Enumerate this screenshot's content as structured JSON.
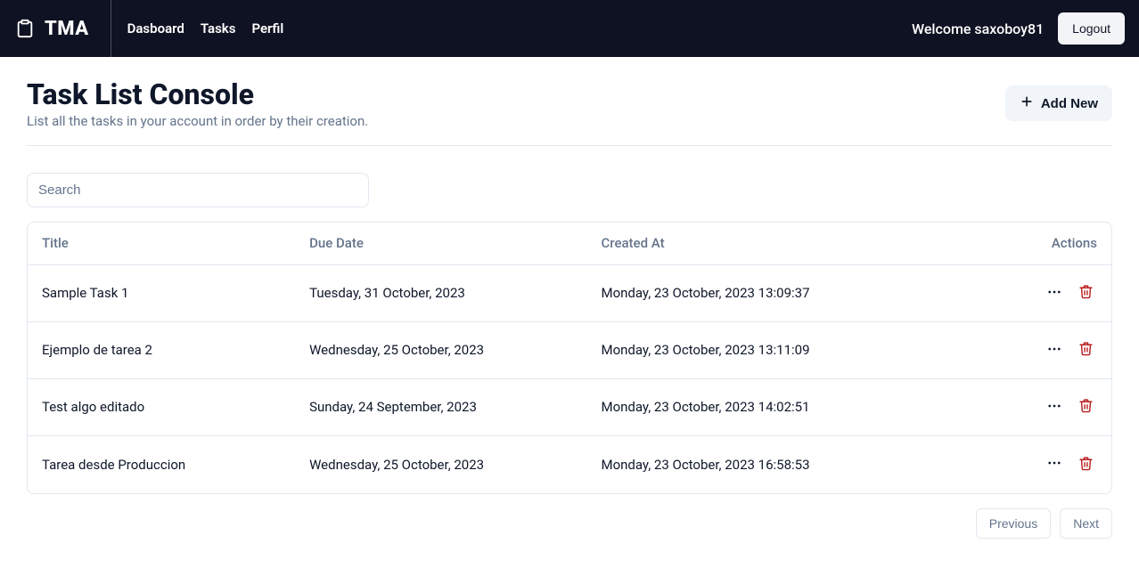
{
  "header": {
    "logo_text": "TMA",
    "nav": [
      {
        "label": "Dasboard"
      },
      {
        "label": "Tasks"
      },
      {
        "label": "Perfil"
      }
    ],
    "welcome_text": "Welcome saxoboy81",
    "logout_label": "Logout"
  },
  "page": {
    "title": "Task List Console",
    "subtitle": "List all the tasks in your account in order by their creation.",
    "add_label": "Add New",
    "search_placeholder": "Search"
  },
  "table": {
    "columns": {
      "title": "Title",
      "due": "Due Date",
      "created": "Created At",
      "actions": "Actions"
    },
    "rows": [
      {
        "title": "Sample Task 1",
        "due": "Tuesday, 31 October, 2023",
        "created": "Monday, 23 October, 2023 13:09:37"
      },
      {
        "title": "Ejemplo de tarea 2",
        "due": "Wednesday, 25 October, 2023",
        "created": "Monday, 23 October, 2023 13:11:09"
      },
      {
        "title": "Test algo editado",
        "due": "Sunday, 24 September, 2023",
        "created": "Monday, 23 October, 2023 14:02:51"
      },
      {
        "title": "Tarea desde Produccion",
        "due": "Wednesday, 25 October, 2023",
        "created": "Monday, 23 October, 2023 16:58:53"
      }
    ]
  },
  "pagination": {
    "previous": "Previous",
    "next": "Next"
  }
}
